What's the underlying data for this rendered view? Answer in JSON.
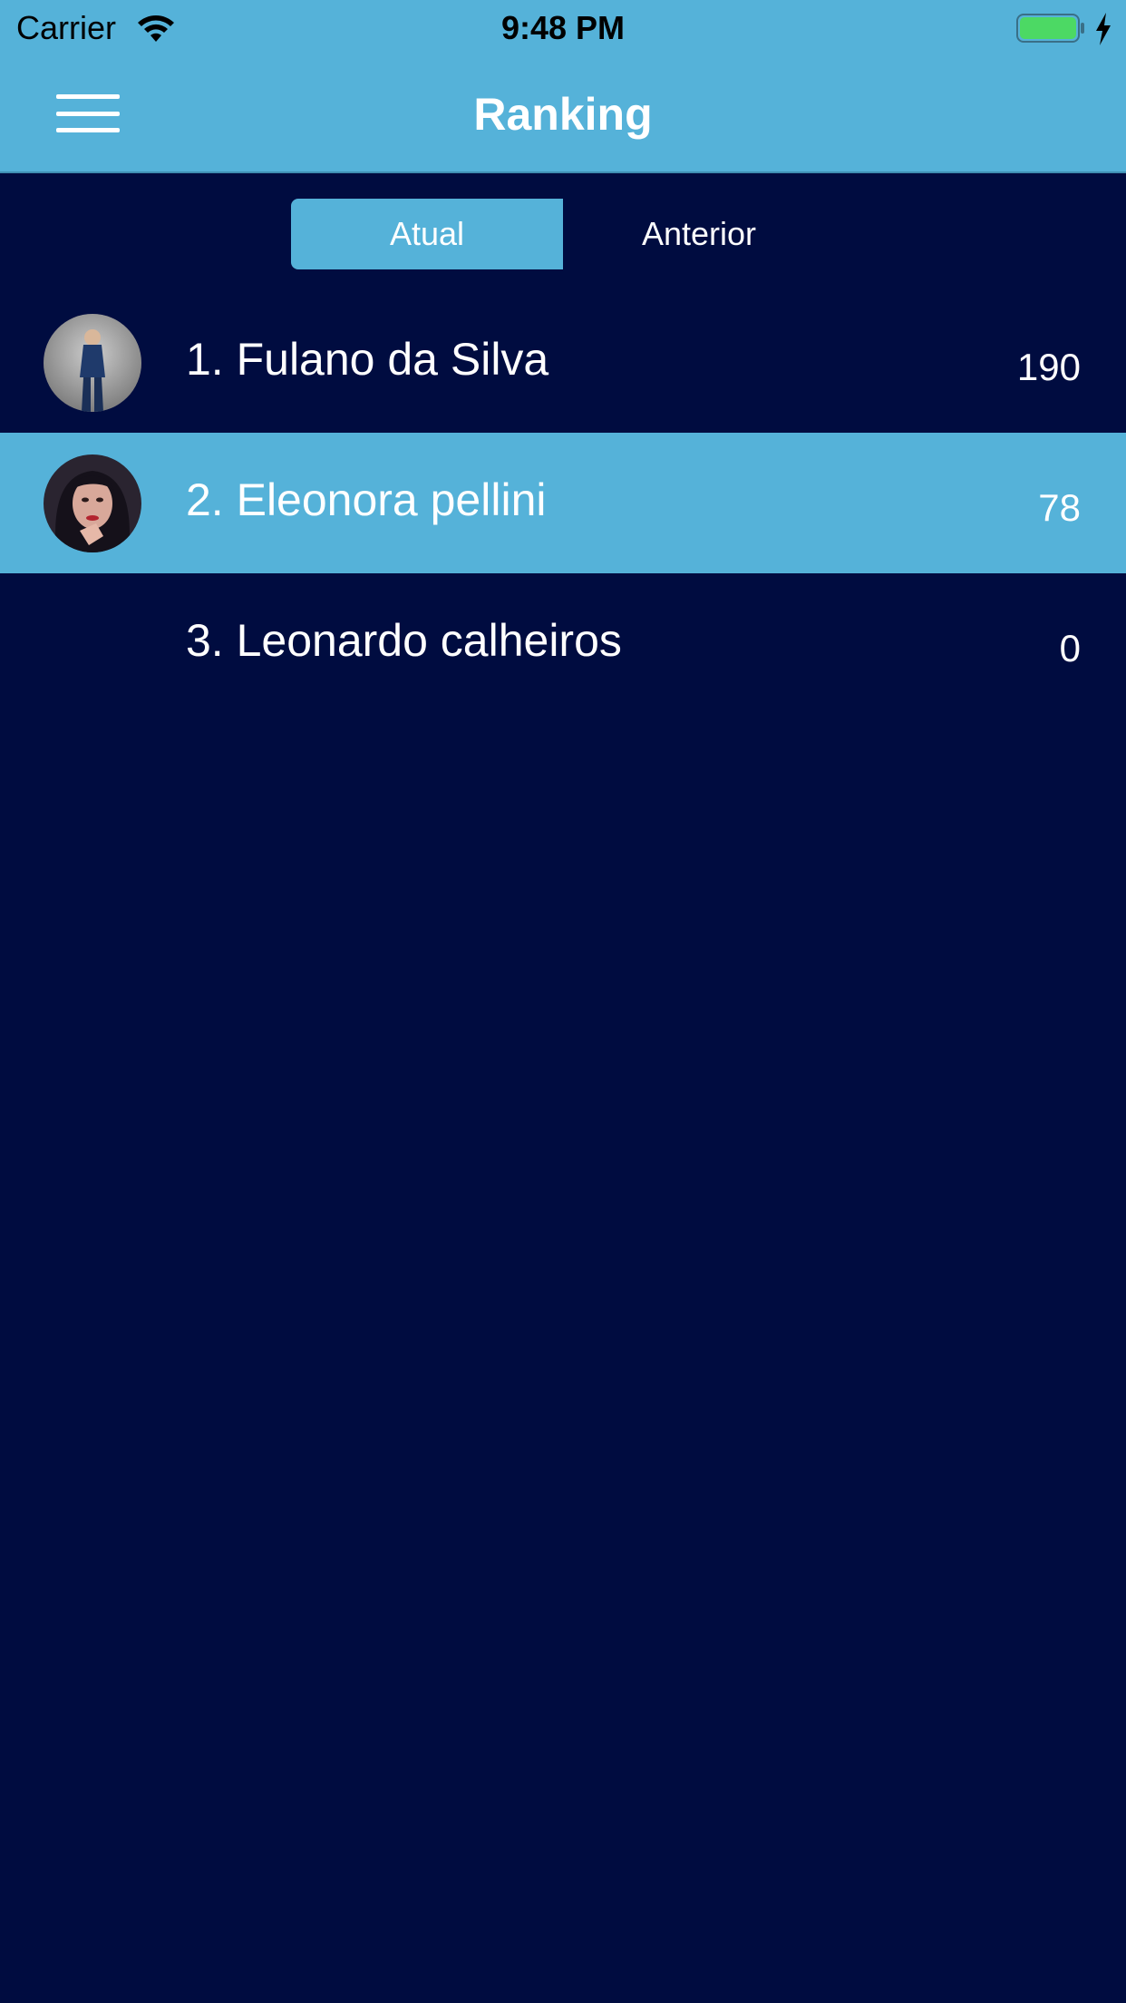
{
  "status_bar": {
    "carrier": "Carrier",
    "time": "9:48 PM",
    "battery_color": "#4cd964"
  },
  "nav": {
    "title": "Ranking",
    "menu_icon": "hamburger-menu-icon"
  },
  "segments": {
    "items": [
      {
        "label": "Atual",
        "selected": true
      },
      {
        "label": "Anterior",
        "selected": false
      }
    ]
  },
  "ranking": {
    "rows": [
      {
        "name": "1. Fulano da Silva",
        "score": "190",
        "has_avatar": true,
        "highlighted": false
      },
      {
        "name": "2. Eleonora pellini",
        "score": "78",
        "has_avatar": true,
        "highlighted": true
      },
      {
        "name": "3. Leonardo calheiros",
        "score": "0",
        "has_avatar": false,
        "highlighted": false
      }
    ]
  },
  "colors": {
    "background": "#000c40",
    "accent": "#55b2d9",
    "text": "#ffffff"
  }
}
